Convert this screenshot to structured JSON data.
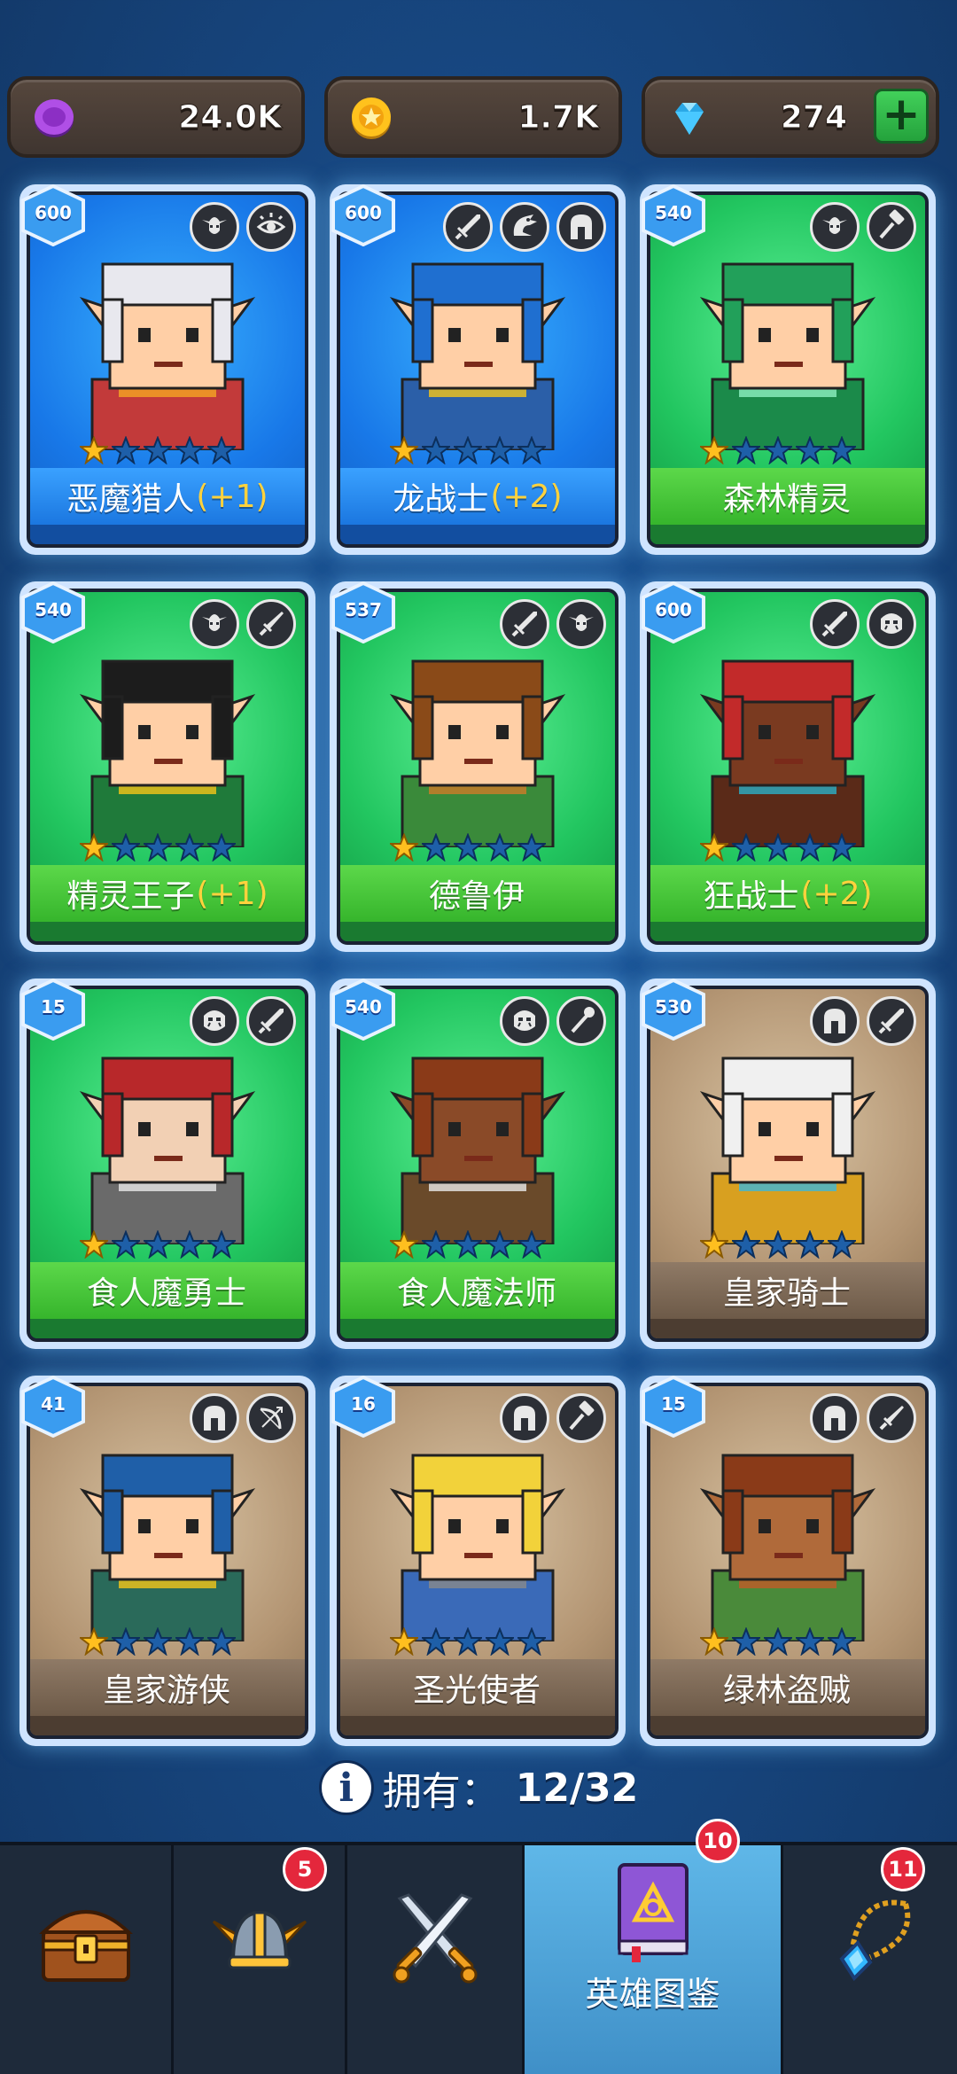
{
  "currencies": [
    {
      "name": "purple-coin",
      "value": "24.0K"
    },
    {
      "name": "gold-coin",
      "value": "1.7K"
    },
    {
      "name": "gem",
      "value": "274"
    }
  ],
  "heroes": [
    {
      "level": "600",
      "name": "恶魔猎人",
      "plus": "(+1)",
      "color": "blue",
      "icons": [
        "elf-icon",
        "eye-icon"
      ],
      "stars": 1
    },
    {
      "level": "600",
      "name": "龙战士",
      "plus": "(+2)",
      "color": "blue",
      "icons": [
        "sword-icon",
        "dragon-icon",
        "helmet-icon"
      ],
      "stars": 1
    },
    {
      "level": "540",
      "name": "森林精灵",
      "plus": "",
      "color": "green",
      "icons": [
        "elf-icon",
        "hammer-icon"
      ],
      "stars": 1
    },
    {
      "level": "540",
      "name": "精灵王子",
      "plus": "(+1)",
      "color": "green",
      "icons": [
        "elf-icon",
        "dagger-icon"
      ],
      "stars": 1
    },
    {
      "level": "537",
      "name": "德鲁伊",
      "plus": "",
      "color": "green",
      "icons": [
        "sword-icon",
        "elf-icon"
      ],
      "stars": 1
    },
    {
      "level": "600",
      "name": "狂战士",
      "plus": "(+2)",
      "color": "green",
      "icons": [
        "sword-icon",
        "orc-icon"
      ],
      "stars": 1
    },
    {
      "level": "15",
      "name": "食人魔勇士",
      "plus": "",
      "color": "green",
      "icons": [
        "orc-icon",
        "sword-icon"
      ],
      "stars": 1
    },
    {
      "level": "540",
      "name": "食人魔法师",
      "plus": "",
      "color": "green",
      "icons": [
        "orc-icon",
        "staff-icon"
      ],
      "stars": 1
    },
    {
      "level": "530",
      "name": "皇家骑士",
      "plus": "",
      "color": "brown",
      "icons": [
        "helmet-icon",
        "sword-icon"
      ],
      "stars": 1
    },
    {
      "level": "41",
      "name": "皇家游侠",
      "plus": "",
      "color": "brown",
      "icons": [
        "helmet-icon",
        "bow-icon"
      ],
      "stars": 1
    },
    {
      "level": "16",
      "name": "圣光使者",
      "plus": "",
      "color": "brown",
      "icons": [
        "helmet-icon",
        "hammer-icon"
      ],
      "stars": 1
    },
    {
      "level": "15",
      "name": "绿林盗贼",
      "plus": "",
      "color": "brown",
      "icons": [
        "helmet-icon",
        "dagger-icon"
      ],
      "stars": 1
    }
  ],
  "owned": {
    "label": "拥有：",
    "value": "12/32"
  },
  "nav": [
    {
      "icon": "chest-icon",
      "label": "",
      "badge": ""
    },
    {
      "icon": "winged-helmet-icon",
      "label": "",
      "badge": "5"
    },
    {
      "icon": "crossed-swords-icon",
      "label": "",
      "badge": ""
    },
    {
      "icon": "book-icon",
      "label": "英雄图鉴",
      "badge": "10"
    },
    {
      "icon": "amulet-icon",
      "label": "",
      "badge": "11"
    }
  ],
  "colors": {
    "blue_card": "#1878e8",
    "green_card": "#22c660",
    "brown_card": "#b39573",
    "star_gold": "#ffbf1f",
    "star_empty": "#1e5fa8",
    "badge_red": "#e4273c"
  }
}
